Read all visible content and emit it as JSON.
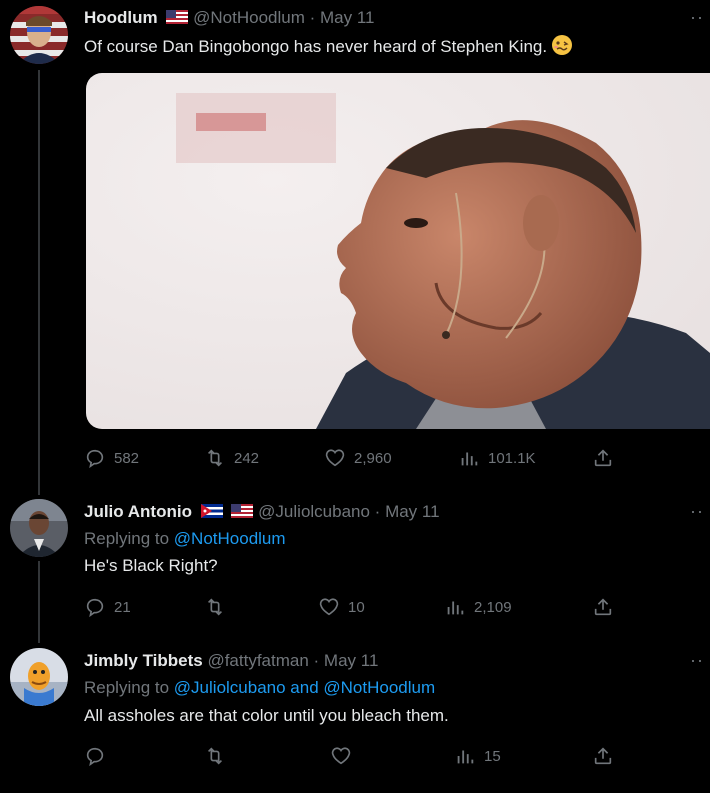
{
  "tweets": [
    {
      "display_name": "Hoodlum",
      "handle": "@NotHoodlum",
      "date": "May 11",
      "text": "Of course Dan Bingobongo has never heard of Stephen King.",
      "emoji": "woozy-face",
      "replies": "582",
      "retweets": "242",
      "likes": "2,960",
      "views": "101.1K"
    },
    {
      "display_name": "Julio Antonio",
      "handle": "@Juliolcubano",
      "date": "May 11",
      "replying_label": "Replying to",
      "replying_to": "@NotHoodlum",
      "text": "He's Black Right?",
      "replies": "21",
      "retweets": "",
      "likes": "10",
      "views": "2,109"
    },
    {
      "display_name": "Jimbly Tibbets",
      "handle": "@fattyfatman",
      "date": "May 11",
      "replying_label": "Replying to",
      "replying_to": "@Juliolcubano and @NotHoodlum",
      "text": "All assholes are that color until you bleach them.",
      "replies": "",
      "retweets": "",
      "likes": "",
      "views": "15"
    }
  ],
  "separator": " · ",
  "colors": {
    "background": "#000000",
    "text": "#e7e9ea",
    "secondary": "#71767b",
    "link": "#1d9bf0",
    "thread_line": "#333639"
  }
}
